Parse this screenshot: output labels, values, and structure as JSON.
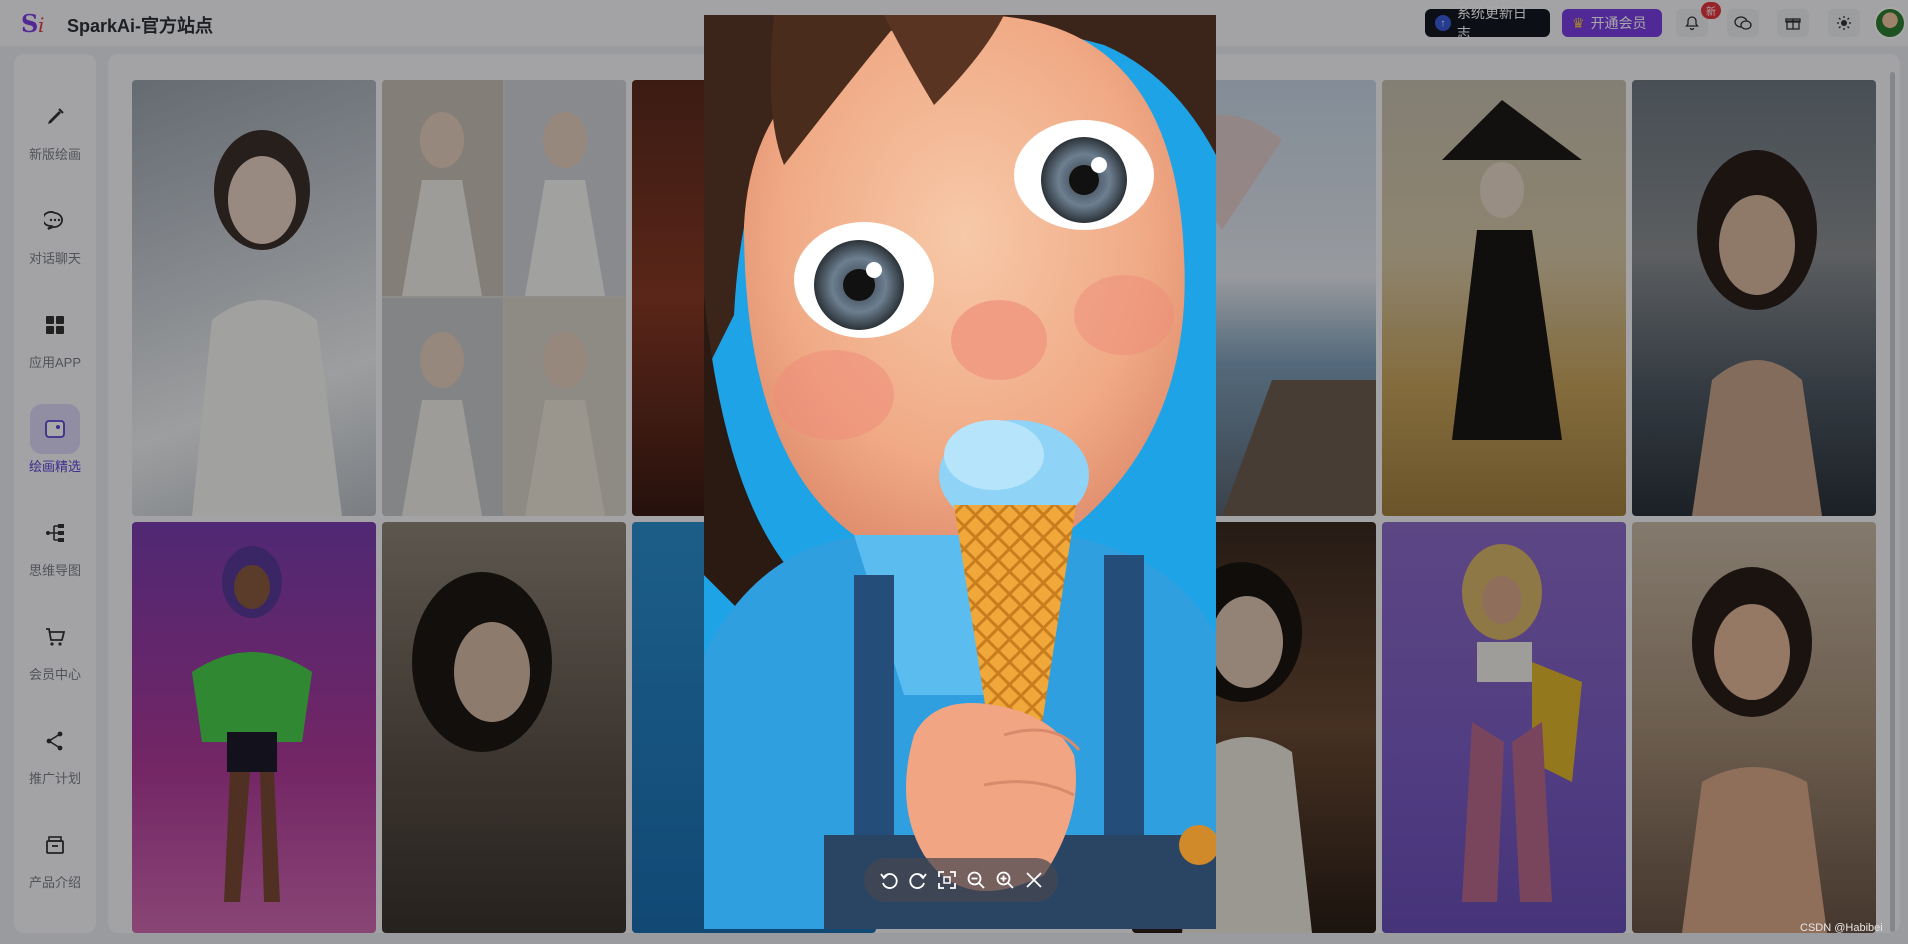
{
  "header": {
    "logo_text": "Si",
    "title": "SparkAi-官方站点",
    "update_button": "系统更新日志",
    "vip_button": "开通会员",
    "notification_badge": "新",
    "icons": [
      "bell-icon",
      "wechat-icon",
      "gift-icon",
      "sun-icon"
    ]
  },
  "sidebar": {
    "items": [
      {
        "label": "新版绘画",
        "icon": "brush-icon"
      },
      {
        "label": "对话聊天",
        "icon": "chat-icon"
      },
      {
        "label": "应用APP",
        "icon": "apps-icon"
      },
      {
        "label": "绘画精选",
        "icon": "gallery-icon",
        "active": true
      },
      {
        "label": "思维导图",
        "icon": "mindmap-icon"
      },
      {
        "label": "会员中心",
        "icon": "cart-icon"
      },
      {
        "label": "推广计划",
        "icon": "share-icon"
      },
      {
        "label": "产品介绍",
        "icon": "box-icon"
      }
    ]
  },
  "gallery": {
    "images": [
      "woman-white-dress",
      "woman-collage",
      "christmas-scene",
      "girl-cartoon",
      "woman-umbrella",
      "witch",
      "woman-black-dress",
      "purple-hair-girl",
      "woman-wet-hair",
      "cartoon-girl-2",
      "woman-portrait",
      "pink-hair-girl",
      "woman-sunset"
    ]
  },
  "viewer": {
    "image": "girl-eating-ice-cream",
    "tools": [
      "rotate-left-icon",
      "rotate-right-icon",
      "fit-screen-icon",
      "zoom-out-icon",
      "zoom-in-icon",
      "close-icon"
    ]
  },
  "watermark": "CSDN @Habibei",
  "colors": {
    "accent": "#7b3fe4",
    "active": "#5b45d8",
    "badge": "#e4363d",
    "dark_button": "#151823"
  }
}
